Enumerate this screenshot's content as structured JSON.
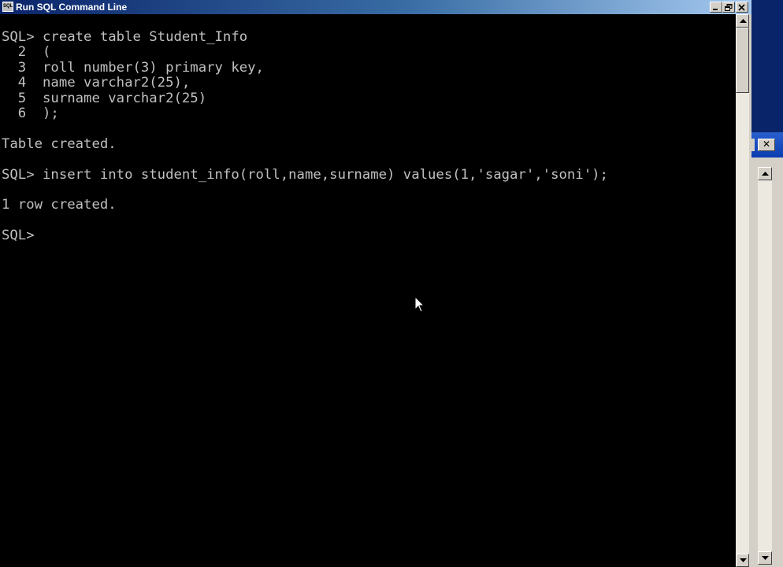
{
  "window": {
    "title": "Run SQL Command Line",
    "icon_label": "SQL"
  },
  "console": {
    "lines": [
      "SQL> create table Student_Info",
      "  2  (",
      "  3  roll number(3) primary key,",
      "  4  name varchar2(25),",
      "  5  surname varchar2(25)",
      "  6  );",
      "",
      "Table created.",
      "",
      "SQL> insert into student_info(roll,name,surname) values(1,'sagar','soni');",
      "",
      "1 row created.",
      "",
      "SQL>"
    ]
  },
  "background_window": {
    "close_glyph": "✕"
  },
  "colors": {
    "console_bg": "#000000",
    "console_text": "#c0c0c0",
    "titlebar_active": "#0a246a"
  }
}
